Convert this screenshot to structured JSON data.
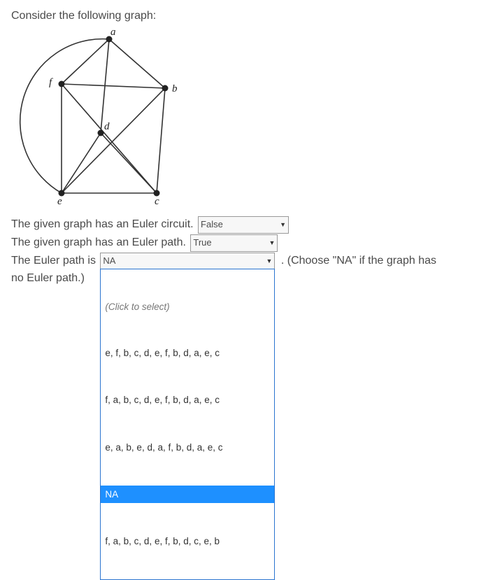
{
  "intro": "Consider the following graph:",
  "graph": {
    "labels": {
      "a": "a",
      "b": "b",
      "c": "c",
      "d": "d",
      "e": "e",
      "f": "f"
    }
  },
  "statements": {
    "s1_prefix": "The given graph has an Euler circuit. ",
    "s1_value": "False",
    "s2_prefix": "The given graph has an Euler path. ",
    "s2_value": "True",
    "s3_prefix": "The Euler path is ",
    "s3_value": "NA",
    "s3_suffix_a": " . (Choose \"NA\" if the graph has",
    "s3_suffix_b": "no Euler path.)"
  },
  "dropdown": {
    "placeholder": "(Click to select)",
    "options": [
      "e, f, b, c, d, e, f, b, d, a, e, c",
      "f, a, b, c, d, e, f, b, d, a, e, c",
      "e, a, b, e, d, a, f, b, d, a, e, c",
      "NA",
      "f, a, b, c, d, e, f, b, d, c, e, b"
    ],
    "selected_index": 3
  }
}
